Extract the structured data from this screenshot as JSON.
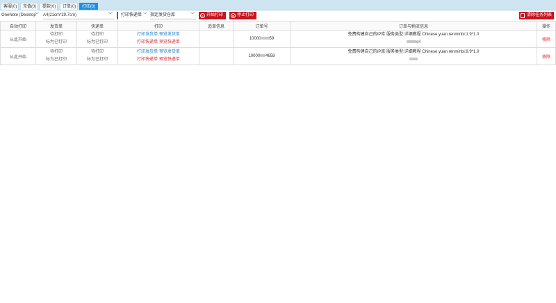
{
  "tabs": [
    {
      "label": "客服(0)"
    },
    {
      "label": "充值(0)"
    },
    {
      "label": "提款(0)"
    },
    {
      "label": "订单(0)"
    },
    {
      "label": "打印(0)",
      "active": true
    }
  ],
  "toolbar": {
    "printer_select": "OneNote (Desktop",
    "paper_select": "A4(21cm*29.7cm)",
    "mode_select": "打印快递单",
    "warehouse_select": "指定发货仓库",
    "start_button": "开始打印",
    "stop_button": "停止打印",
    "clear_button": "清除任务列表"
  },
  "table": {
    "headers": [
      "自动打印",
      "发货单",
      "快递单",
      "打印",
      "追单信息",
      "订单号",
      "订单与物流信息",
      "操作"
    ],
    "rows": [
      {
        "auto": "从此开始",
        "ship_status": "待打印",
        "ship_mark": "标为已打印",
        "exp_status": "待打印",
        "exp_mark": "标为已打印",
        "print_ship": "打印发货单",
        "preview_ship": "预览发货单",
        "print_exp": "打印快递单",
        "preview_exp": "预览快递单",
        "track": "",
        "order_prefix": "10000",
        "order_suffix": "59",
        "info": "免费构建自己的IP库 服务类型:详细教程 Chinese yuan renminbi:1.9*1.0",
        "info_suffix": "ell",
        "action": "移除"
      },
      {
        "auto": "从此开始",
        "ship_status": "待打印",
        "ship_mark": "标为已打印",
        "exp_status": "待打印",
        "exp_mark": "标为已打印",
        "print_ship": "打印发货单",
        "preview_ship": "预览发货单",
        "print_exp": "打印快递单",
        "preview_exp": "预览快递单",
        "track": "",
        "order_prefix": "10000",
        "order_suffix": "4658",
        "info": "免费构建自己的IP库 服务类型:详细教程 Chinese yuan renminbi:9.9*1.0",
        "info_suffix": "",
        "action": "移除"
      }
    ]
  },
  "colors": {
    "accent": "#1d8fe0",
    "danger": "#c9151e",
    "link_blue": "#1d7fcb",
    "link_red": "#e0262e"
  }
}
